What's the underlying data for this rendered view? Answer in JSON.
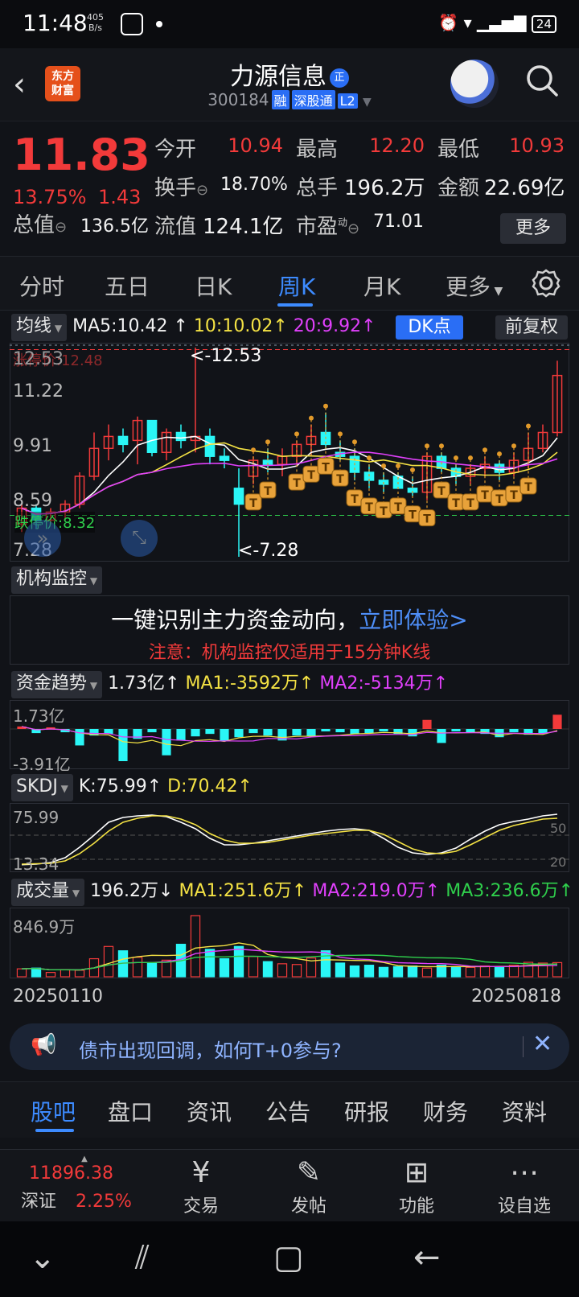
{
  "status": {
    "time": "11:48",
    "speed_top": "405",
    "speed_bottom": "B/s",
    "battery": "24"
  },
  "header": {
    "logo_line1": "东方",
    "logo_line2": "财富",
    "name": "力源信息",
    "name_badge": "正",
    "code": "300184",
    "tag1": "融",
    "tag2": "深股通",
    "tag3": "L2"
  },
  "quote": {
    "price": "11.83",
    "pct": "13.75%",
    "change": "1.43",
    "open_label": "今开",
    "open": "10.94",
    "high_label": "最高",
    "high": "12.20",
    "low_label": "最低",
    "low": "10.93",
    "turnover_label": "换手",
    "turnover": "18.70%",
    "volume_label": "总手",
    "volume": "196.2万",
    "amount_label": "金额",
    "amount": "22.69亿",
    "mktcap_label": "总值",
    "mktcap": "136.5亿",
    "float_label": "流值",
    "float": "124.1亿",
    "pe_label": "市盈",
    "pe_sup": "动",
    "pe": "71.01",
    "more": "更多"
  },
  "ktabs": [
    "分时",
    "五日",
    "日K",
    "周K",
    "月K",
    "更多"
  ],
  "ma": {
    "selector": "均线",
    "ma5": "MA5:10.42",
    "ma10": "10:10.02",
    "ma20": "20:9.92",
    "dk": "DK点",
    "fq": "前复权"
  },
  "main_chart": {
    "y_labels": [
      "12.53",
      "11.22",
      "9.91",
      "8.59",
      "7.28"
    ],
    "limit_up": "涨停价:12.48",
    "limit_down": "跌停价:8.32",
    "max_mark": "<-12.53",
    "min_mark": "<-7.28"
  },
  "jigou": {
    "selector": "机构监控",
    "headline": "一键识别主力资金动向，",
    "link": "立即体验>",
    "note": "注意：机构监控仅适用于15分钟K线"
  },
  "fund": {
    "selector": "资金趋势",
    "val": "1.73亿",
    "ma1": "MA1:-3592万",
    "ma2": "MA2:-5134万",
    "top": "1.73亿",
    "bottom": "-3.91亿"
  },
  "skdj": {
    "selector": "SKDJ",
    "k": "K:75.99",
    "d": "D:70.42",
    "top": "75.99",
    "bottom": "13.34",
    "r50": "50",
    "r20": "20"
  },
  "vol": {
    "selector": "成交量",
    "val": "196.2万",
    "ma1": "MA1:251.6万",
    "ma2": "MA2:219.0万",
    "ma3": "MA3:236.6万",
    "top": "846.9万"
  },
  "dates": {
    "start": "20250110",
    "end": "20250818"
  },
  "banner": {
    "text": "债市出现回调，如何T+0参与?"
  },
  "btabs": [
    "股吧",
    "盘口",
    "资讯",
    "公告",
    "研报",
    "财务",
    "资料"
  ],
  "footer": {
    "index_value": "11896.38",
    "index_name": "深证",
    "index_pct": "2.25%",
    "items": [
      "交易",
      "发帖",
      "功能",
      "设自选"
    ]
  },
  "colors": {
    "up": "#f23a3a",
    "down": "#2af6f6",
    "accent": "#3d8bff",
    "ma5": "#ffffff",
    "ma10": "#f4e244",
    "ma20": "#e040fb"
  },
  "chart_data": {
    "type": "candlestick",
    "period": "weekly",
    "ohlc": [
      [
        8.1,
        8.6,
        7.9,
        8.5
      ],
      [
        8.5,
        8.6,
        8.0,
        8.2
      ],
      [
        8.2,
        8.5,
        8.1,
        8.4
      ],
      [
        8.4,
        8.7,
        8.2,
        8.6
      ],
      [
        8.6,
        9.4,
        8.5,
        9.3
      ],
      [
        9.3,
        10.4,
        9.2,
        10.0
      ],
      [
        10.0,
        10.6,
        9.7,
        10.3
      ],
      [
        10.3,
        10.5,
        9.9,
        10.1
      ],
      [
        10.2,
        10.8,
        9.6,
        10.7
      ],
      [
        10.7,
        10.7,
        9.8,
        9.9
      ],
      [
        9.9,
        10.5,
        9.7,
        10.4
      ],
      [
        10.4,
        10.6,
        10.0,
        10.2
      ],
      [
        10.2,
        12.53,
        9.9,
        10.3
      ],
      [
        10.3,
        10.5,
        9.6,
        9.8
      ],
      [
        9.8,
        10.0,
        9.5,
        9.7
      ],
      [
        9.0,
        9.5,
        7.28,
        8.6
      ],
      [
        9.3,
        9.8,
        9.1,
        9.7
      ],
      [
        9.7,
        10.0,
        9.4,
        9.6
      ],
      [
        9.6,
        10.0,
        9.3,
        9.8
      ],
      [
        9.8,
        10.2,
        9.6,
        10.1
      ],
      [
        10.1,
        10.6,
        9.8,
        10.3
      ],
      [
        10.4,
        10.9,
        10.0,
        10.1
      ],
      [
        9.9,
        10.2,
        9.7,
        9.8
      ],
      [
        9.8,
        10.0,
        9.2,
        9.4
      ],
      [
        9.4,
        9.6,
        9.0,
        9.2
      ],
      [
        9.2,
        9.4,
        8.9,
        9.1
      ],
      [
        9.3,
        9.4,
        9.0,
        9.0
      ],
      [
        9.0,
        9.3,
        8.8,
        8.9
      ],
      [
        8.9,
        9.9,
        8.7,
        9.8
      ],
      [
        9.8,
        9.9,
        9.4,
        9.5
      ],
      [
        9.5,
        9.6,
        9.1,
        9.3
      ],
      [
        9.3,
        9.6,
        9.1,
        9.5
      ],
      [
        9.5,
        9.8,
        9.3,
        9.6
      ],
      [
        9.6,
        9.7,
        9.2,
        9.4
      ],
      [
        9.4,
        9.9,
        9.3,
        9.7
      ],
      [
        9.7,
        10.4,
        9.5,
        10.0
      ],
      [
        10.0,
        10.6,
        9.9,
        10.4
      ],
      [
        10.4,
        12.2,
        10.3,
        11.83
      ]
    ],
    "ylim": [
      7.28,
      12.53
    ]
  }
}
